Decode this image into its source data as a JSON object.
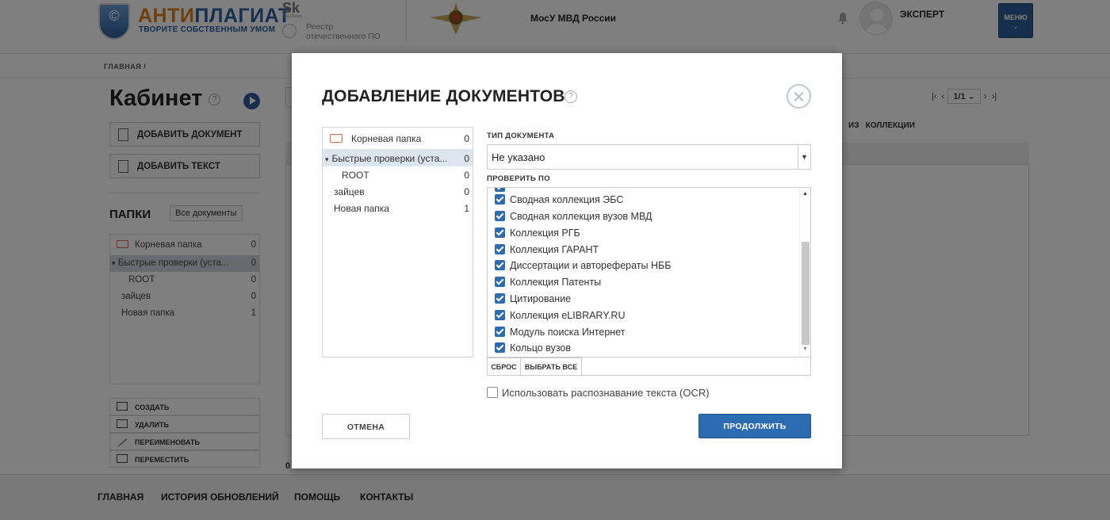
{
  "header": {
    "logo_text_a": "АНТИ",
    "logo_text_b": "ПЛАГИАТ",
    "logo_tagline": "ТВОРИТЕ СОБСТВЕННЫМ УМОМ",
    "logo_symbol": "©",
    "sk_text": "Sk",
    "sk_sub": "Skolkovo",
    "reestr_line1": "Реестр",
    "reestr_line2": "отечественного ПО",
    "organization": "МосУ МВД России",
    "user_role": "ЭКСПЕРТ",
    "menu_label": "МЕНЮ",
    "menu_chevron": "⌄"
  },
  "breadcrumb": "ГЛАВНАЯ /",
  "cabinet": {
    "title": "Кабинет",
    "help_icon": "?",
    "add_document": "ДОБАВИТЬ ДОКУМЕНТ",
    "add_text": "ДОБАВИТЬ ТЕКСТ",
    "folders_title": "ПАПКИ",
    "all_documents": "Все документы",
    "folders": [
      {
        "name": "Корневая папка",
        "count": "0"
      },
      {
        "name": "Быстрые проверки (уста...",
        "count": "0"
      },
      {
        "name": "ROOT",
        "count": "0"
      },
      {
        "name": "зайцев",
        "count": "0"
      },
      {
        "name": "Новая папка",
        "count": "1"
      }
    ],
    "folder_actions": [
      "СОЗДАТЬ",
      "УДАЛИТЬ",
      "ПЕРЕИМЕНОВАТЬ",
      "ПЕРЕМЕСТИТЬ"
    ]
  },
  "pager": {
    "value": "1/1"
  },
  "collections_label": "КОЛЛЕКЦИИ",
  "from_label": "ИЗ",
  "documents_count": "0",
  "footer": [
    "ГЛАВНАЯ",
    "ИСТОРИЯ ОБНОВЛЕНИЙ",
    "ПОМОЩЬ",
    "КОНТАКТЫ"
  ],
  "modal": {
    "title": "ДОБАВЛЕНИЕ ДОКУМЕНТОВ",
    "help_icon": "?",
    "tree": [
      {
        "name": "Корневая папка",
        "count": "0"
      },
      {
        "name": "Быстрые проверки (уста...",
        "count": "0"
      },
      {
        "name": "ROOT",
        "count": "0"
      },
      {
        "name": "зайцев",
        "count": "0"
      },
      {
        "name": "Новая папка",
        "count": "1"
      }
    ],
    "doc_type_label": "ТИП ДОКУМЕНТА",
    "doc_type_value": "Не указано",
    "check_by_label": "ПРОВЕРИТЬ ПО",
    "collections": [
      "Сводная коллекция ЭБС",
      "Сводная коллекция вузов МВД",
      "Коллекция РГБ",
      "Коллекция ГАРАНТ",
      "Диссертации и авторефераты НББ",
      "Коллекция Патенты",
      "Цитирование",
      "Коллекция eLIBRARY.RU",
      "Модуль поиска Интернет",
      "Кольцо вузов"
    ],
    "reset_label": "СБРОС",
    "select_all_label": "ВЫБРАТЬ ВСЕ",
    "ocr_label": "Использовать распознавание текста (OCR)",
    "ocr_checked": false,
    "cancel_label": "ОТМЕНА",
    "continue_label": "ПРОДОЛЖИТЬ",
    "accent_color": "#2c6cb0"
  }
}
